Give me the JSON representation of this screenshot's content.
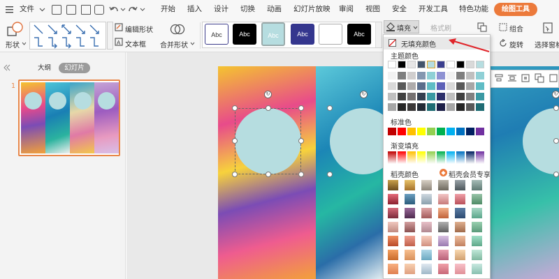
{
  "menu": {
    "file": "文件",
    "tabs": [
      "开始",
      "插入",
      "设计",
      "切换",
      "动画",
      "幻灯片放映",
      "审阅",
      "视图",
      "安全",
      "开发工具",
      "特色功能"
    ],
    "drawing_tools": "绘图工具"
  },
  "ribbon": {
    "shape_label": "形状",
    "edit_shape": "编辑形状",
    "text_box": "文本框",
    "merge_shape": "合并形状",
    "style_label": "Abc",
    "fill": "填充",
    "format_brush": "格式刷",
    "group": "组合",
    "rotate": "旋转",
    "selection_pane": "选择窗格"
  },
  "left_pane": {
    "outline_tab": "大纲",
    "slides_tab": "幻灯片",
    "slide_number": "1"
  },
  "fill_menu": {
    "no_fill": "无填充颜色",
    "theme_colors": "主题颜色",
    "standard_colors": "标准色",
    "gradient_fill": "渐变填充",
    "shell_colors": "稻壳颜色",
    "member_exclusive": "稻壳会员专享"
  },
  "colors": {
    "accent": "#ec7a3b",
    "selected_style": "#b6dde0",
    "circle_fill": "#b6dde0",
    "standard": [
      "#c00000",
      "#ff0000",
      "#ffc000",
      "#ffff00",
      "#92d050",
      "#00b050",
      "#00b0f0",
      "#0070c0",
      "#002060",
      "#7030a0"
    ],
    "gradient": [
      "#c00000",
      "#ff0000",
      "#ffc000",
      "#ffff00",
      "#92d050",
      "#00b050",
      "#00b0f0",
      "#0070c0",
      "#002060",
      "#7030a0"
    ]
  }
}
